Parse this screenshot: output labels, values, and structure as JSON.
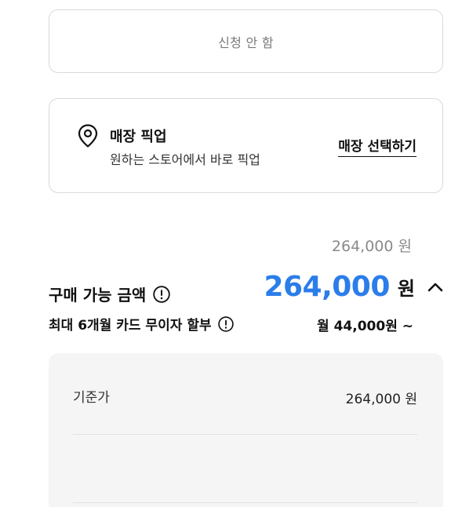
{
  "no_apply": {
    "label": "신청 안 함"
  },
  "pickup": {
    "icon": "location-pin-icon",
    "title": "매장 픽업",
    "subtitle": "원하는 스토어에서 바로 픽업",
    "select_label": "매장 선택하기"
  },
  "price": {
    "original": "264,000 원",
    "purchase_label": "구매 가능 금액",
    "amount": "264,000",
    "unit": "원",
    "accent_color": "#2b7de9",
    "installment_label": "최대 6개월 카드 무이자 할부",
    "installment_value": "월 44,000원 ~"
  },
  "details": {
    "rows": [
      {
        "label": "기준가",
        "value": "264,000 원"
      }
    ]
  }
}
